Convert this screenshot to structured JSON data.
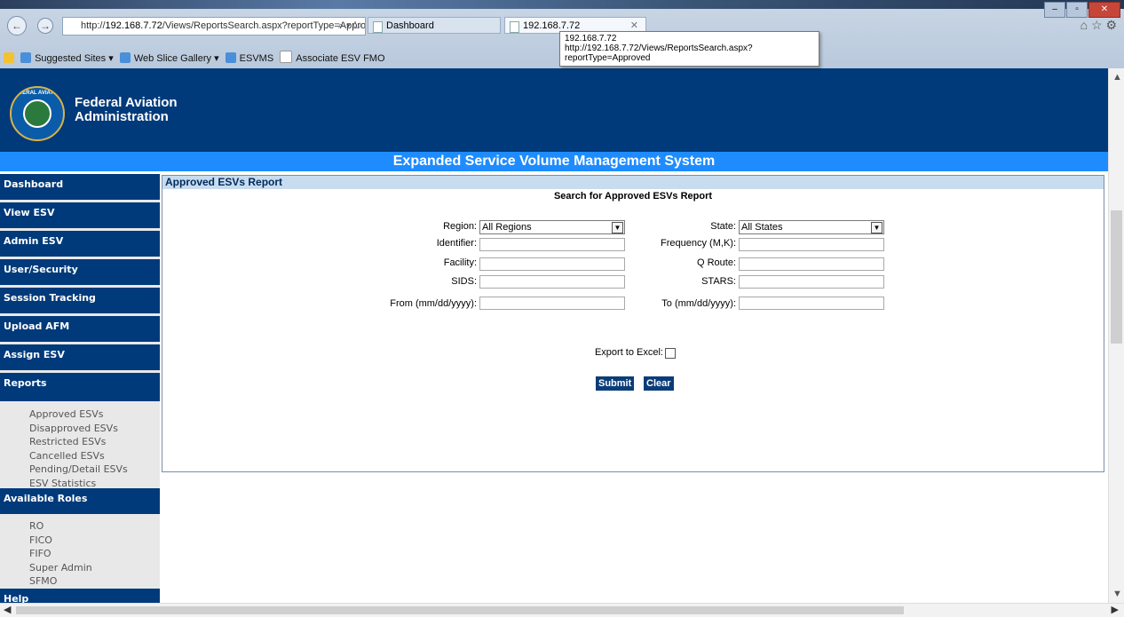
{
  "browser": {
    "url_prefix": "http://",
    "url_host": "192.168.7.72",
    "url_path": "/Views/ReportsSearch.aspx?reportType=Approvec",
    "tabs": [
      {
        "label": "Dashboard"
      },
      {
        "label": "192.168.7.72"
      }
    ],
    "tooltip_line1": "192.168.7.72",
    "tooltip_line2": "http://192.168.7.72/Views/ReportsSearch.aspx?reportType=Approved",
    "favorites": [
      {
        "label": "Suggested Sites ▾"
      },
      {
        "label": "Web Slice Gallery ▾"
      },
      {
        "label": "ESVMS"
      },
      {
        "label": "Associate ESV FMO"
      }
    ]
  },
  "header": {
    "org_line1": "Federal Aviation",
    "org_line2": "Administration",
    "logo_text": "FEDERAL AVIATION",
    "banner": "Expanded Service Volume Management System"
  },
  "sidebar": {
    "menu": [
      {
        "label": "Dashboard"
      },
      {
        "label": "View ESV"
      },
      {
        "label": "Admin ESV"
      },
      {
        "label": "User/Security"
      },
      {
        "label": "Session Tracking"
      },
      {
        "label": "Upload AFM"
      },
      {
        "label": "Assign ESV"
      },
      {
        "label": "Reports"
      }
    ],
    "reports": [
      "Approved ESVs",
      "Disapproved ESVs",
      "Restricted ESVs",
      "Cancelled ESVs",
      "Pending/Detail ESVs",
      "ESV Statistics"
    ],
    "roles_label": "Available Roles",
    "roles": [
      "RO",
      "FICO",
      "FIFO",
      "Super Admin",
      "SFMO"
    ],
    "help_label": "Help"
  },
  "content": {
    "title": "Approved ESVs Report",
    "search_title": "Search for Approved ESVs Report",
    "labels": {
      "region": "Region:",
      "state": "State:",
      "identifier": "Identifier:",
      "frequency": "Frequency (M,K):",
      "facility": "Facility:",
      "q_route": "Q Route:",
      "sids": "SIDS:",
      "stars": "STARS:",
      "from": "From (mm/dd/yyyy):",
      "to": "To (mm/dd/yyyy):",
      "export": "Export to Excel:"
    },
    "region_value": "All Regions",
    "state_value": "All States",
    "submit_label": "Submit",
    "clear_label": "Clear"
  }
}
